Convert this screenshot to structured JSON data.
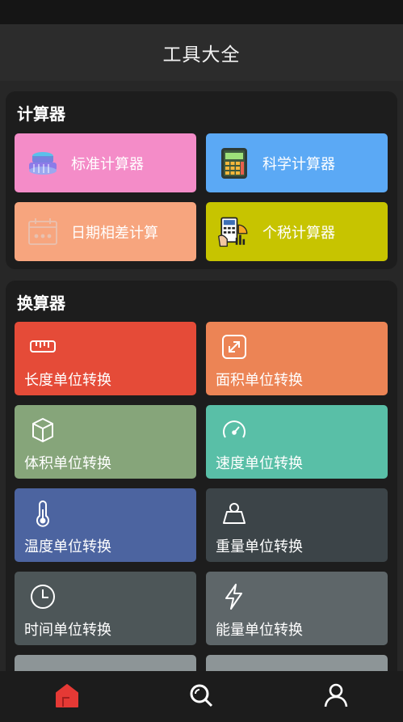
{
  "header": {
    "title": "工具大全"
  },
  "calculators": {
    "title": "计算器",
    "items": [
      {
        "label": "标准计算器",
        "icon": "coin-stack-icon",
        "color": "#F48CC8"
      },
      {
        "label": "科学计算器",
        "icon": "scientific-calculator-icon",
        "color": "#5BA9F5"
      },
      {
        "label": "日期相差计算",
        "icon": "calendar-icon",
        "color": "#F7A57E"
      },
      {
        "label": "个税计算器",
        "icon": "tax-calculator-icon",
        "color": "#C7C400"
      }
    ]
  },
  "converters": {
    "title": "换算器",
    "items": [
      {
        "label": "长度单位转换",
        "icon": "ruler-icon",
        "color": "#E54B38"
      },
      {
        "label": "面积单位转换",
        "icon": "area-expand-icon",
        "color": "#EC8455"
      },
      {
        "label": "体积单位转换",
        "icon": "cylinder-icon",
        "color": "#86A57A"
      },
      {
        "label": "速度单位转换",
        "icon": "speedometer-icon",
        "color": "#59BFA7"
      },
      {
        "label": "温度单位转换",
        "icon": "thermometer-icon",
        "color": "#4C64A0"
      },
      {
        "label": "重量单位转换",
        "icon": "weight-icon",
        "color": "#3C4448"
      },
      {
        "label": "时间单位转换",
        "icon": "clock-icon",
        "color": "#4D5658"
      },
      {
        "label": "能量单位转换",
        "icon": "lightning-icon",
        "color": "#5E6669"
      }
    ]
  },
  "bottom_nav": {
    "items": [
      {
        "icon": "home-icon",
        "active": true,
        "color": "#E53935"
      },
      {
        "icon": "search-icon",
        "active": false,
        "color": "#FFFFFF"
      },
      {
        "icon": "profile-icon",
        "active": false,
        "color": "#FFFFFF"
      }
    ]
  }
}
